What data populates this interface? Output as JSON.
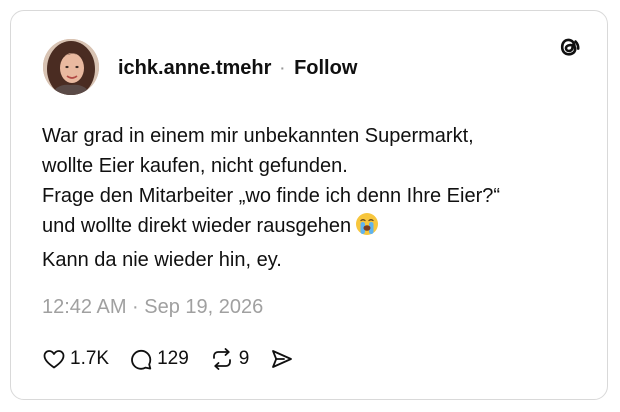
{
  "post": {
    "username": "ichk.anne.tmehr",
    "separator": "·",
    "follow_label": "Follow",
    "text_lines": [
      "War grad in einem mir unbekannten Supermarkt,",
      "wollte Eier kaufen, nicht gefunden.",
      "Frage den Mitarbeiter „wo finde ich denn Ihre Eier?“",
      "und wollte direkt wieder rausgehen",
      "Kann da nie wieder hin, ey."
    ],
    "emoji": "loudly-crying-face",
    "timestamp": "12:42 AM · Sep 19, 2026"
  },
  "actions": {
    "likes": "1.7K",
    "replies": "129",
    "reposts": "9"
  },
  "icons": {
    "logo": "threads-logo-icon",
    "like": "heart-icon",
    "reply": "comment-bubble-icon",
    "repost": "repost-icon",
    "share": "send-icon"
  },
  "colors": {
    "text": "#101010",
    "muted": "#a0a0a0",
    "border": "#d9d9d9"
  }
}
